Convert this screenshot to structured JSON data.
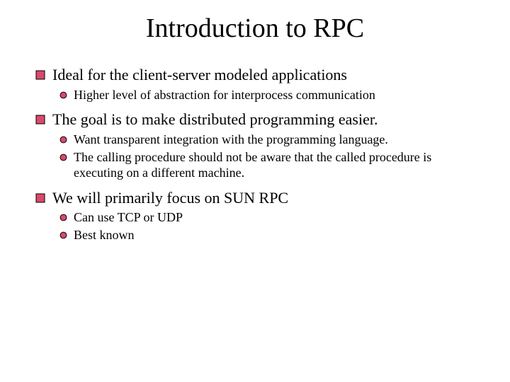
{
  "title": "Introduction to RPC",
  "bullets": [
    {
      "text": "Ideal for the client-server modeled applications",
      "subs": [
        "Higher level of abstraction for interprocess communication"
      ]
    },
    {
      "text": "The goal is to make distributed programming easier.",
      "subs": [
        "Want transparent integration with the programming language.",
        "The calling procedure should not be aware that the called procedure is executing on a different machine."
      ]
    },
    {
      "text": "We will primarily focus on SUN RPC",
      "subs": [
        "Can use TCP or UDP",
        "Best known"
      ]
    }
  ]
}
